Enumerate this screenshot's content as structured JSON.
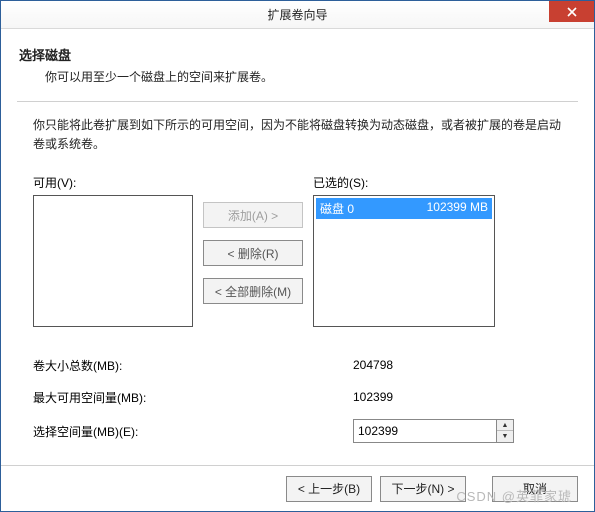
{
  "window": {
    "title": "扩展卷向导"
  },
  "header": {
    "title": "选择磁盘",
    "subtitle": "你可以用至少一个磁盘上的空间来扩展卷。"
  },
  "description": "你只能将此卷扩展到如下所示的可用空间，因为不能将磁盘转换为动态磁盘，或者被扩展的卷是启动卷或系统卷。",
  "available": {
    "label": "可用(V):"
  },
  "selected": {
    "label": "已选的(S):",
    "items": [
      {
        "name": "磁盘 0",
        "size": "102399 MB",
        "selected": true
      }
    ]
  },
  "transfer": {
    "add": "添加(A) >",
    "remove": "< 删除(R)",
    "removeAll": "< 全部删除(M)"
  },
  "fields": {
    "totalSize": {
      "label": "卷大小总数(MB):",
      "value": "204798"
    },
    "maxAvail": {
      "label": "最大可用空间量(MB):",
      "value": "102399"
    },
    "selectAmt": {
      "label": "选择空间量(MB)(E):",
      "value": "102399"
    }
  },
  "footer": {
    "back": "< 上一步(B)",
    "next": "下一步(N) >",
    "cancel": "取消"
  },
  "watermark": "CSDN @英菲家琥"
}
